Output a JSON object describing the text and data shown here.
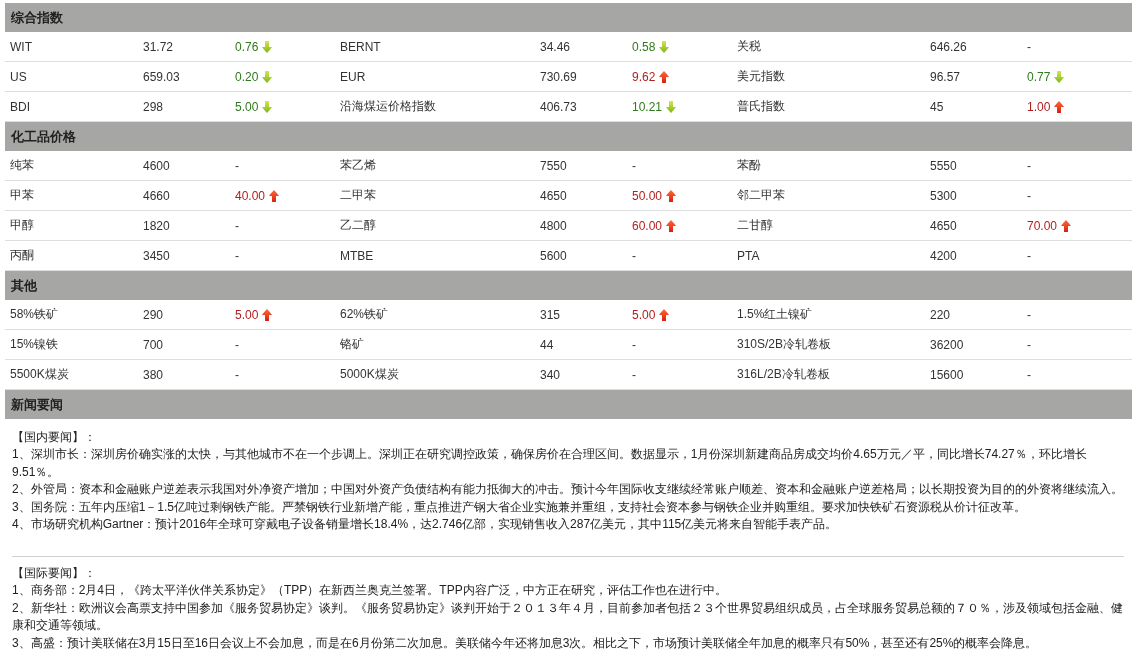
{
  "sections": [
    {
      "kind": "table",
      "title": "综合指数",
      "rows": [
        [
          {
            "name": "WIT",
            "price": "31.72",
            "change": "0.76",
            "kind": "down"
          },
          {
            "name": "BERNT",
            "price": "34.46",
            "change": "0.58",
            "kind": "down"
          },
          {
            "name": "关税",
            "price": "646.26",
            "change": "-",
            "kind": "flat"
          }
        ],
        [
          {
            "name": "US",
            "price": "659.03",
            "change": "0.20",
            "kind": "down"
          },
          {
            "name": "EUR",
            "price": "730.69",
            "change": "9.62",
            "kind": "up"
          },
          {
            "name": "美元指数",
            "price": "96.57",
            "change": "0.77",
            "kind": "down"
          }
        ],
        [
          {
            "name": "BDI",
            "price": "298",
            "change": "5.00",
            "kind": "down"
          },
          {
            "name": "沿海煤运价格指数",
            "price": "406.73",
            "change": "10.21",
            "kind": "down"
          },
          {
            "name": "普氏指数",
            "price": "45",
            "change": "1.00",
            "kind": "up"
          }
        ]
      ]
    },
    {
      "kind": "table",
      "title": "化工品价格",
      "rows": [
        [
          {
            "name": "纯苯",
            "price": "4600",
            "change": "-",
            "kind": "flat"
          },
          {
            "name": "苯乙烯",
            "price": "7550",
            "change": "-",
            "kind": "flat"
          },
          {
            "name": "苯酚",
            "price": "5550",
            "change": "-",
            "kind": "flat"
          }
        ],
        [
          {
            "name": "甲苯",
            "price": "4660",
            "change": "40.00",
            "kind": "up"
          },
          {
            "name": "二甲苯",
            "price": "4650",
            "change": "50.00",
            "kind": "up"
          },
          {
            "name": "邻二甲苯",
            "price": "5300",
            "change": "-",
            "kind": "flat"
          }
        ],
        [
          {
            "name": "甲醇",
            "price": "1820",
            "change": "-",
            "kind": "flat"
          },
          {
            "name": "乙二醇",
            "price": "4800",
            "change": "60.00",
            "kind": "up"
          },
          {
            "name": "二甘醇",
            "price": "4650",
            "change": "70.00",
            "kind": "up"
          }
        ],
        [
          {
            "name": "丙酮",
            "price": "3450",
            "change": "-",
            "kind": "flat"
          },
          {
            "name": "MTBE",
            "price": "5600",
            "change": "-",
            "kind": "flat"
          },
          {
            "name": "PTA",
            "price": "4200",
            "change": "-",
            "kind": "flat"
          }
        ]
      ]
    },
    {
      "kind": "table",
      "title": "其他",
      "rows": [
        [
          {
            "name": "58%铁矿",
            "price": "290",
            "change": "5.00",
            "kind": "up"
          },
          {
            "name": "62%铁矿",
            "price": "315",
            "change": "5.00",
            "kind": "up"
          },
          {
            "name": "1.5%红土镍矿",
            "price": "220",
            "change": "-",
            "kind": "flat"
          }
        ],
        [
          {
            "name": "15%镍铁",
            "price": "700",
            "change": "-",
            "kind": "flat"
          },
          {
            "name": "铬矿",
            "price": "44",
            "change": "-",
            "kind": "flat"
          },
          {
            "name": "310S/2B冷轧卷板",
            "price": "36200",
            "change": "-",
            "kind": "flat"
          }
        ],
        [
          {
            "name": "5500K煤炭",
            "price": "380",
            "change": "-",
            "kind": "flat"
          },
          {
            "name": "5000K煤炭",
            "price": "340",
            "change": "-",
            "kind": "flat"
          },
          {
            "name": "316L/2B冷轧卷板",
            "price": "15600",
            "change": "-",
            "kind": "flat"
          }
        ]
      ]
    },
    {
      "kind": "news",
      "title": "新闻要闻",
      "groups": [
        {
          "heading": "【国内要闻】：",
          "items": [
            "1、深圳市长：深圳房价确实涨的太快，与其他城市不在一个步调上。深圳正在研究调控政策，确保房价在合理区间。数据显示，1月份深圳新建商品房成交均价4.65万元／平，同比增长74.27％，环比增长9.51％。",
            "2、外管局：资本和金融账户逆差表示我国对外净资产增加；中国对外资产负债结构有能力抵御大的冲击。预计今年国际收支继续经常账户顺差、资本和金融账户逆差格局；以长期投资为目的的外资将继续流入。",
            "3、国务院：五年内压缩1－1.5亿吨过剩钢铁产能。严禁钢铁行业新增产能，重点推进产钢大省企业实施兼并重组，支持社会资本参与钢铁企业并购重组。要求加快铁矿石资源税从价计征改革。",
            "4、市场研究机构Gartner：预计2016年全球可穿戴电子设备销量增长18.4%，达2.746亿部，实现销售收入287亿美元，其中115亿美元将来自智能手表产品。"
          ]
        },
        {
          "heading": "【国际要闻】：",
          "items": [
            "1、商务部：2月4日，《跨太平洋伙伴关系协定》（TPP）在新西兰奥克兰签署。TPP内容广泛，中方正在研究，评估工作也在进行中。",
            "2、新华社：欧洲议会高票支持中国参加《服务贸易协定》谈判。《服务贸易协定》谈判开始于２０１３年４月，目前参加者包括２３个世界贸易组织成员，占全球服务贸易总额的７０％，涉及领域包括金融、健康和交通等领域。",
            "3、高盛：预计美联储在3月15日至16日会议上不会加息，而是在6月份第二次加息。美联储今年还将加息3次。相比之下，市场预计美联储全年加息的概率只有50%，甚至还有25%的概率会降息。"
          ]
        }
      ]
    }
  ]
}
